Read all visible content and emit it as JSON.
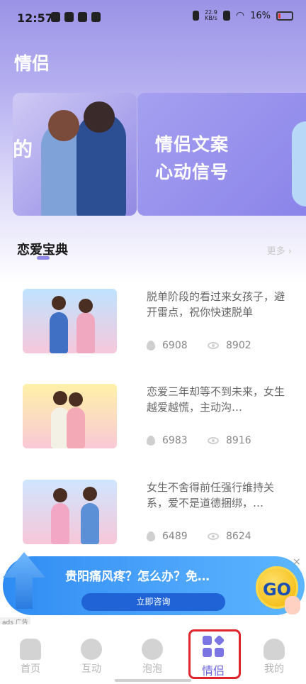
{
  "status_bar": {
    "time": "12:57",
    "net_speed_top": "22.9",
    "net_speed_bottom": "KB/s",
    "battery": "16%"
  },
  "page": {
    "title": "情侣"
  },
  "banners": {
    "left_partial_text": "的",
    "right_line1": "情侣文案",
    "right_line2": "心动信号"
  },
  "section": {
    "title": "恋爱宝典",
    "more": "更多 ›"
  },
  "articles": [
    {
      "title": "脱单阶段的看过来女孩子，避开雷点，祝你快速脱单",
      "hot": "6908",
      "views": "8902"
    },
    {
      "title": "恋爱三年却等不到未来，女生越爱越慌，主动沟…",
      "hot": "6983",
      "views": "8916"
    },
    {
      "title": "女生不舍得前任强行维持关系，爱不是道德捆绑，…",
      "hot": "6489",
      "views": "8624"
    }
  ],
  "ad": {
    "title": "贵阳痛风疼？怎么办？免…",
    "cta": "立即咨询",
    "go": "GO",
    "close": "×",
    "tag": "ads 广告"
  },
  "nav": {
    "items": [
      {
        "label": "首页"
      },
      {
        "label": "互动"
      },
      {
        "label": "泡泡"
      },
      {
        "label": "情侣"
      },
      {
        "label": "我的"
      }
    ],
    "active_color": "#6d66dd",
    "inactive_color": "#b5b5b5"
  }
}
